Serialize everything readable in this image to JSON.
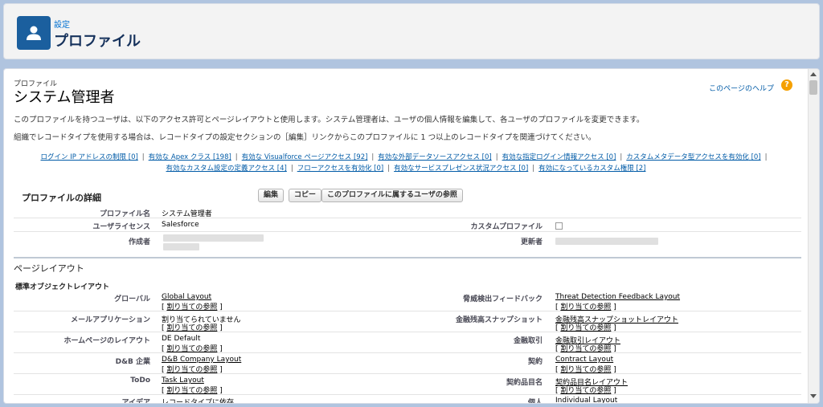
{
  "header": {
    "breadcrumb": "設定",
    "title": "プロファイル"
  },
  "profile": {
    "eyebrow": "プロファイル",
    "name": "システム管理者",
    "help_link": "このページのヘルプ",
    "help_icon": "?",
    "description_1": "このプロファイルを持つユーザは、以下のアクセス許可とページレイアウトと使用します。システム管理者は、ユーザの個人情報を編集して、各ユーザのプロファイルを変更できます。",
    "description_2": "組織でレコードタイプを使用する場合は、レコードタイプの設定セクションの［編集］リンクからこのプロファイルに 1 つ以上のレコードタイプを関連づけてください。"
  },
  "quick_links": {
    "row1": [
      {
        "label": "ログイン IP アドレスの制限",
        "count": "[0]"
      },
      {
        "label": "有効な Apex クラス",
        "count": "[198]"
      },
      {
        "label": "有効な Visualforce ページアクセス",
        "count": "[92]"
      },
      {
        "label": "有効な外部データソースアクセス",
        "count": "[0]"
      },
      {
        "label": "有効な指定ログイン情報アクセス",
        "count": "[0]"
      },
      {
        "label": "カスタムメタデータ型アクセスを有効化",
        "count": "[0]"
      }
    ],
    "row2": [
      {
        "label": "有効なカスタム設定の定義アクセス",
        "count": "[4]"
      },
      {
        "label": "フローアクセスを有効化",
        "count": "[0]"
      },
      {
        "label": "有効なサービスプレゼンス状況アクセス",
        "count": "[0]"
      },
      {
        "label": "有効になっているカスタム権限",
        "count": "[2]"
      }
    ]
  },
  "details": {
    "section_title": "プロファイルの詳細",
    "buttons": {
      "edit": "編集",
      "copy": "コピー",
      "view_users": "このプロファイルに属するユーザの参照"
    },
    "fields": {
      "profile_name_label": "プロファイル名",
      "profile_name_value": "システム管理者",
      "user_license_label": "ユーザライセンス",
      "user_license_value": "Salesforce",
      "custom_profile_label": "カスタムプロファイル",
      "created_by_label": "作成者",
      "modified_by_label": "更新者"
    }
  },
  "page_layouts": {
    "section_title": "ページレイアウト",
    "subsection_title": "標準オブジェクトレイアウト",
    "assign_view": "割り当ての参照",
    "rows": [
      {
        "left_label": "グローバル",
        "left_value": "Global Layout",
        "left_is_link": true,
        "right_label": "脅威検出フィードバック",
        "right_value": "Threat Detection Feedback Layout",
        "right_is_link": true
      },
      {
        "left_label": "メールアプリケーション",
        "left_value": "割り当てられていません",
        "left_is_link": false,
        "right_label": "金融残高スナップショット",
        "right_value": "金融残高スナップショットレイアウト",
        "right_is_link": true
      },
      {
        "left_label": "ホームページのレイアウト",
        "left_value": "DE Default",
        "left_is_link": false,
        "right_label": "金融取引",
        "right_value": "金融取引レイアウト",
        "right_is_link": true
      },
      {
        "left_label": "D&B 企業",
        "left_value": "D&B Company Layout",
        "left_is_link": true,
        "right_label": "契約",
        "right_value": "Contract Layout",
        "right_is_link": true
      },
      {
        "left_label": "ToDo",
        "left_value": "Task Layout",
        "left_is_link": true,
        "right_label": "契約品目名",
        "right_value": "契約品目名レイアウト",
        "right_is_link": true
      },
      {
        "left_label": "アイデア",
        "left_value": "レコードタイプに依存",
        "left_is_link": false,
        "right_label": "個人",
        "right_value": "Individual Layout",
        "right_is_link": true
      }
    ]
  }
}
